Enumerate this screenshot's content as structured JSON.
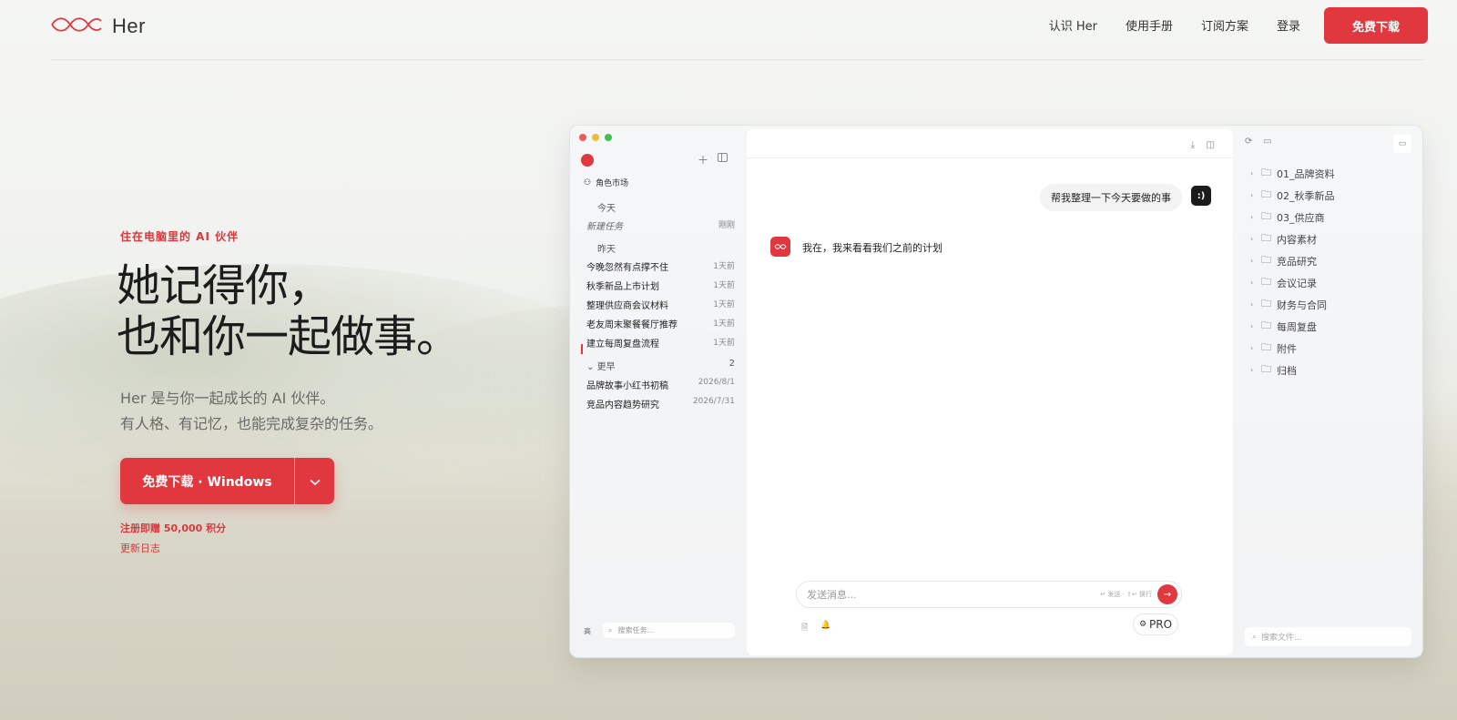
{
  "brand": {
    "name": "Her",
    "accent": "#e0383e",
    "logo_icon": "infinity-wave-icon"
  },
  "nav": {
    "links": [
      "认识 Her",
      "使用手册",
      "订阅方案",
      "登录"
    ],
    "cta": "免费下载"
  },
  "hero": {
    "eyebrow": "住在电脑里的 AI 伙伴",
    "headline_line1": "她记得你，",
    "headline_line2": "也和你一起做事。",
    "sub_line1": "Her 是与你一起成长的 AI 伙伴。",
    "sub_line2": "有人格、有记忆，也能完成复杂的任务。",
    "download_label": "免费下载 · Windows",
    "credit": "注册即赠 50,000 积分",
    "changelog": "更新日志"
  },
  "app": {
    "sidebar": {
      "market": "角色市场",
      "today_label": "今天",
      "new_task": {
        "title": "新建任务",
        "meta": "刚刚"
      },
      "yesterday_label": "昨天",
      "yesterday_tasks": [
        {
          "title": "今晚忽然有点撑不住",
          "meta": "1天前"
        },
        {
          "title": "秋季新品上市计划",
          "meta": "1天前"
        },
        {
          "title": "整理供应商会议材料",
          "meta": "1天前"
        },
        {
          "title": "老友周末聚餐餐厅推荐",
          "meta": "1天前"
        },
        {
          "title": "建立每周复盘流程",
          "meta": "1天前"
        }
      ],
      "earlier_label": "更早",
      "earlier_count": "2",
      "earlier_tasks": [
        {
          "title": "品牌故事小红书初稿",
          "meta": "2026/8/1"
        },
        {
          "title": "竞品内容趋势研究",
          "meta": "2026/7/31"
        }
      ],
      "bottom_label": "高",
      "search_placeholder": "搜索任务..."
    },
    "chat": {
      "user_message": "帮我整理一下今天要做的事",
      "user_avatar": ":)",
      "ai_message": "我在，我来看看我们之前的计划",
      "composer_placeholder": "发送消息...",
      "composer_hint": "↵ 发送 · ⇧↵ 换行",
      "pro_label": "PRO"
    },
    "files": {
      "folders": [
        "01_品牌资料",
        "02_秋季新品",
        "03_供应商",
        "内容素材",
        "竞品研究",
        "会议记录",
        "财务与合同",
        "每周复盘",
        "附件",
        "归档"
      ],
      "search_placeholder": "搜索文件..."
    }
  }
}
